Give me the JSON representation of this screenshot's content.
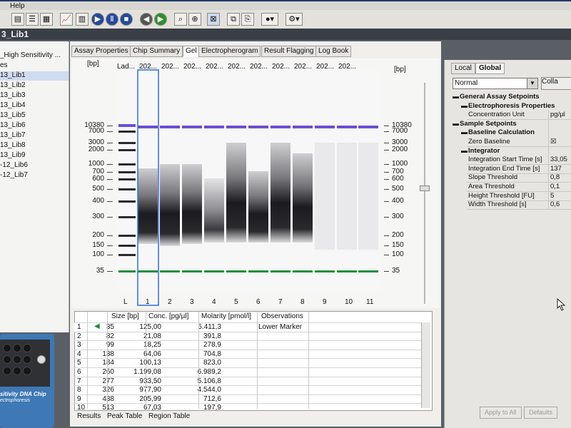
{
  "menubar": {
    "help": "Help"
  },
  "file_header": {
    "name": "3_Lib1"
  },
  "tree": {
    "items": [
      {
        "label": "_High Sensitivity ..."
      },
      {
        "label": "es"
      },
      {
        "label": "13_Lib1"
      },
      {
        "label": "13_Lib2"
      },
      {
        "label": "13_Lib3"
      },
      {
        "label": "13_Lib4"
      },
      {
        "label": "13_Lib5"
      },
      {
        "label": "13_Lib6"
      },
      {
        "label": "13_Lib7"
      },
      {
        "label": "13_Lib8"
      },
      {
        "label": "13_Lib9"
      },
      {
        "label": "-12_Lib6"
      },
      {
        "label": "-12_Lib7"
      }
    ]
  },
  "chip": {
    "label": "sitivity DNA Chip",
    "sublabel": "ectrophoresis"
  },
  "tabs": [
    {
      "label": "Assay Properties"
    },
    {
      "label": "Chip Summary"
    },
    {
      "label": "Gel"
    },
    {
      "label": "Electropherogram"
    },
    {
      "label": "Result Flagging"
    },
    {
      "label": "Log Book"
    }
  ],
  "gel": {
    "axis_unit_left": "[bp]",
    "axis_unit_right": "[bp]",
    "lane_headers": [
      "Lad...",
      "202...",
      "202...",
      "202...",
      "202...",
      "202...",
      "202...",
      "202...",
      "202...",
      "202...",
      "202..."
    ],
    "lane_numbers": [
      "L",
      "1",
      "2",
      "3",
      "4",
      "5",
      "6",
      "7",
      "8",
      "9",
      "10",
      "11"
    ],
    "left_labels": [
      "10380",
      "7000",
      "3000",
      "2000",
      "1000",
      "700",
      "600",
      "500",
      "400",
      "300",
      "200",
      "150",
      "100",
      "35"
    ],
    "right_labels": [
      "10380",
      "7000",
      "3000",
      "2000",
      "1000",
      "700",
      "600",
      "500",
      "400",
      "300",
      "200",
      "150",
      "100",
      "35"
    ],
    "upper_marker_color": "#6a4fd6",
    "lower_marker_color": "#1f8f3a",
    "selected_lane": "1",
    "selection_color": "#2f6fd8"
  },
  "table": {
    "headers": [
      "Size [bp]",
      "Conc. [pg/µl]",
      "Molarity [pmol/l]",
      "Observations"
    ],
    "rows": [
      {
        "n": "1",
        "size": "35",
        "conc": "125,00",
        "mol": "5.411,3",
        "obs": "Lower Marker"
      },
      {
        "n": "2",
        "size": "82",
        "conc": "21,08",
        "mol": "391,8",
        "obs": ""
      },
      {
        "n": "3",
        "size": "99",
        "conc": "18,25",
        "mol": "278,9",
        "obs": ""
      },
      {
        "n": "4",
        "size": "138",
        "conc": "64,06",
        "mol": "704,8",
        "obs": ""
      },
      {
        "n": "5",
        "size": "184",
        "conc": "100,13",
        "mol": "823,0",
        "obs": ""
      },
      {
        "n": "6",
        "size": "260",
        "conc": "1.199,08",
        "mol": "6.989,2",
        "obs": ""
      },
      {
        "n": "7",
        "size": "277",
        "conc": "933,50",
        "mol": "5.106,8",
        "obs": ""
      },
      {
        "n": "8",
        "size": "326",
        "conc": "977,90",
        "mol": "4.544,0",
        "obs": ""
      },
      {
        "n": "9",
        "size": "438",
        "conc": "205,99",
        "mol": "712,6",
        "obs": ""
      },
      {
        "n": "10",
        "size": "513",
        "conc": "67,03",
        "mol": "197,9",
        "obs": ""
      }
    ],
    "bottom_tabs": [
      "Results",
      "Peak Table",
      "Region Table"
    ]
  },
  "right_panel": {
    "tabs": [
      "Local",
      "Global"
    ],
    "select_value": "Normal",
    "collapse_label": "Colla",
    "sections": [
      {
        "label": "General Assay Setpoints"
      },
      {
        "label": "Electrophoresis Properties"
      },
      {
        "label": "Concentration Unit",
        "value": "pg/µl"
      },
      {
        "label": "Sample Setpoints"
      },
      {
        "label": "Baseline Calculation"
      },
      {
        "label": "Zero Baseline",
        "value": "☒"
      },
      {
        "label": "Integrator"
      },
      {
        "label": "Integration Start Time [s]",
        "value": "33,05"
      },
      {
        "label": "Integration End Time [s]",
        "value": "137"
      },
      {
        "label": "Slope Threshold",
        "value": "0,8"
      },
      {
        "label": "Area Threshold",
        "value": "0,1"
      },
      {
        "label": "Height Threshold [FU]",
        "value": "5"
      },
      {
        "label": "Width Threshold [s]",
        "value": "0,6"
      }
    ],
    "buttons": [
      "Apply to All",
      "Defaults"
    ]
  }
}
